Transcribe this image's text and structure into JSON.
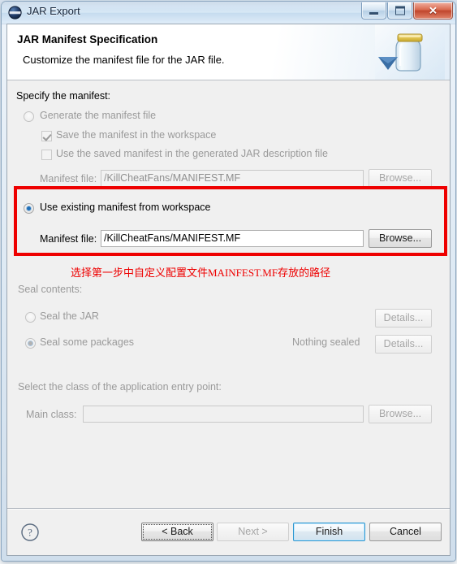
{
  "window": {
    "title": "JAR Export",
    "app_icon": "eclipse-globe-icon",
    "controls": {
      "minimize": "Minimize",
      "maximize": "Maximize",
      "close": "✕"
    }
  },
  "header": {
    "title": "JAR Manifest Specification",
    "subtitle": "Customize the manifest file for the JAR file.",
    "art_icon": "jar-jar-icon"
  },
  "form": {
    "specify_label": "Specify the manifest:",
    "generate_radio": {
      "label": "Generate the manifest file",
      "selected": false,
      "enabled": false
    },
    "save_checkbox": {
      "label": "Save the manifest in the workspace",
      "checked": true,
      "enabled": false
    },
    "use_saved_checkbox": {
      "label": "Use the saved manifest in the generated JAR description file",
      "checked": false,
      "enabled": false
    },
    "generate_manifest_file": {
      "label": "Manifest file:",
      "value": "/KillCheatFans/MANIFEST.MF",
      "browse_label": "Browse...",
      "enabled": false
    },
    "use_existing_radio": {
      "label": "Use existing manifest from workspace",
      "selected": true,
      "enabled": true
    },
    "existing_manifest_file": {
      "label": "Manifest file:",
      "value": "/KillCheatFans/MANIFEST.MF",
      "browse_label": "Browse...",
      "enabled": true
    },
    "seal_contents_label": "Seal contents:",
    "seal_jar_radio": {
      "label": "Seal the JAR",
      "selected": false,
      "enabled": false
    },
    "seal_jar_details": "Details...",
    "seal_packages_radio": {
      "label": "Seal some packages",
      "selected": true,
      "enabled": false
    },
    "seal_packages_status": "Nothing sealed",
    "seal_packages_details": "Details...",
    "entry_point_label": "Select the class of the application entry point:",
    "main_class": {
      "label": "Main class:",
      "value": "",
      "browse_label": "Browse...",
      "enabled": false
    }
  },
  "annotation": {
    "text": "选择第一步中自定义配置文件MAINFEST.MF存放的路径",
    "color": "#ee0000"
  },
  "buttons": {
    "help": "help-icon",
    "back": "< Back",
    "next": "Next >",
    "finish": "Finish",
    "cancel": "Cancel"
  },
  "colors": {
    "accent": "#2c96d0",
    "annotation": "#ee0000",
    "dialog_bg": "#f0f0f0"
  }
}
